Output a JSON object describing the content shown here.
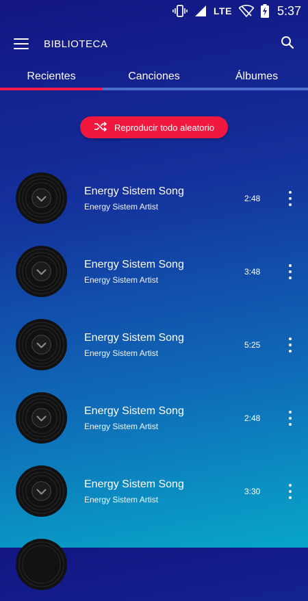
{
  "status": {
    "network": "LTE",
    "time": "5:37"
  },
  "header": {
    "title": "BIBLIOTECA"
  },
  "tabs": [
    {
      "label": "Recientes",
      "active": true
    },
    {
      "label": "Canciones",
      "active": false
    },
    {
      "label": "Álbumes",
      "active": false
    }
  ],
  "shuffle": {
    "label": "Reproducir todo aleatorio"
  },
  "songs": [
    {
      "title": "Energy Sistem Song",
      "artist": "Energy Sistem Artist",
      "duration": "2:48"
    },
    {
      "title": "Energy Sistem Song",
      "artist": "Energy Sistem Artist",
      "duration": "3:48"
    },
    {
      "title": "Energy Sistem Song",
      "artist": "Energy Sistem Artist",
      "duration": "5:25"
    },
    {
      "title": "Energy Sistem Song",
      "artist": "Energy Sistem Artist",
      "duration": "2:48"
    },
    {
      "title": "Energy Sistem Song",
      "artist": "Energy Sistem Artist",
      "duration": "3:30"
    }
  ],
  "colors": {
    "accent": "#f0183f",
    "indicator_track": "#4a6fcf"
  }
}
